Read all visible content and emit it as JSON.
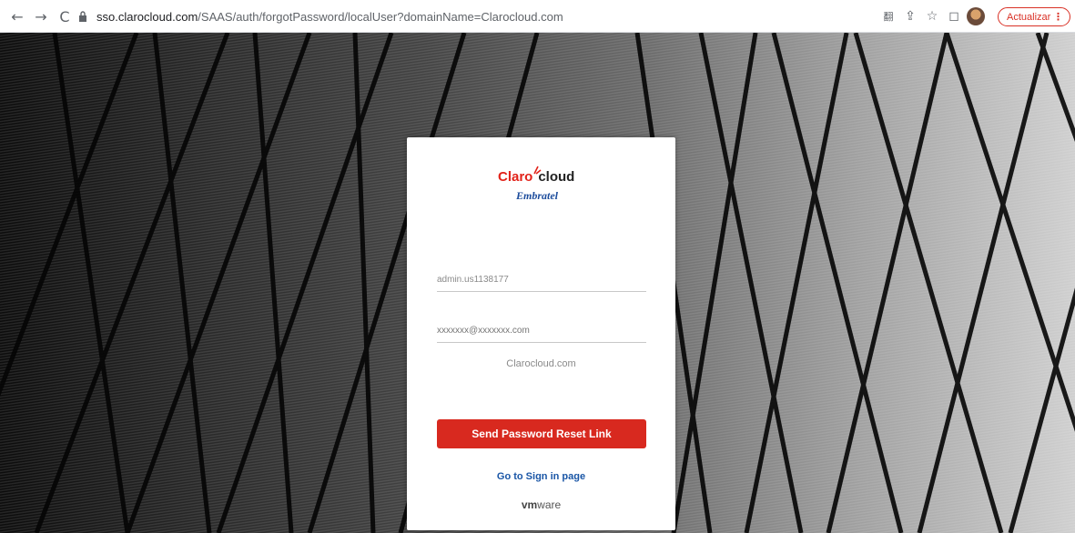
{
  "browser": {
    "back_icon": "←",
    "forward_icon": "→",
    "reload_icon": "C",
    "url_host": "sso.clarocloud.com",
    "url_path": "/SAAS/auth/forgotPassword/localUser?domainName=Clarocloud.com",
    "update_label": "Actualizar",
    "update_menu": "⋮",
    "translate_icon": "翻",
    "share_icon": "⇪",
    "star_icon": "☆",
    "sidepanel_icon": "◻",
    "accent": "#d93025"
  },
  "logo": {
    "claro": "Claro",
    "cloud": "cloud",
    "embratel": "Embratel"
  },
  "form": {
    "username_value": "admin.us1138177",
    "email_placeholder": "xxxxxxx@xxxxxxx.com",
    "domain": "Clarocloud.com",
    "submit_label": "Send Password Reset Link",
    "signin_link": "Go to Sign in page",
    "button_color": "#d8291f"
  },
  "footer": {
    "vm": "vm",
    "ware": "ware"
  }
}
